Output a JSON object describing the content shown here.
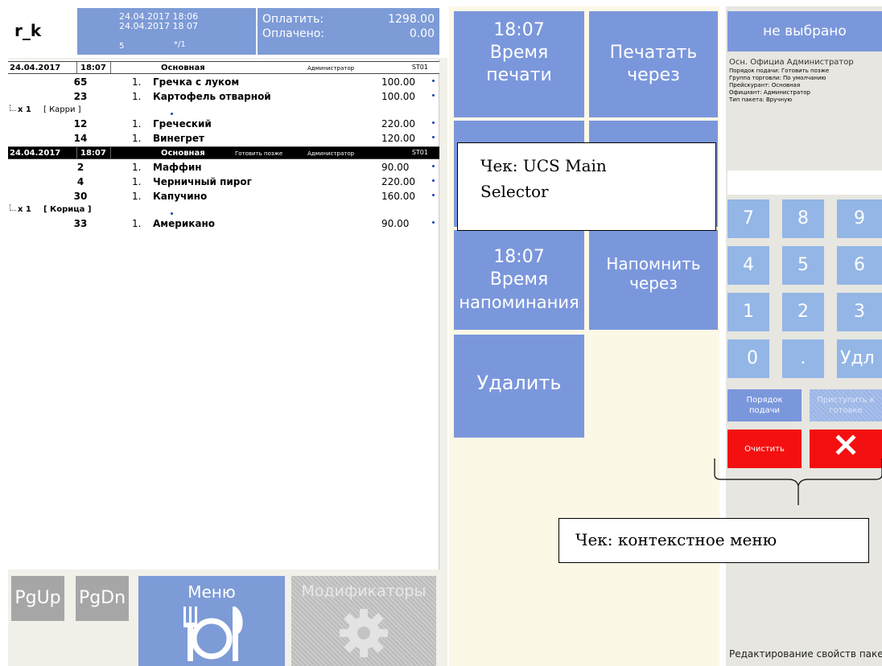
{
  "header": {
    "app_code": "r_k",
    "datetime_open": "24.04.2017 18:06",
    "datetime_print": "24.04.2017 18 07",
    "guests": "5",
    "table": "*/1",
    "pay_label": "Оплатить:",
    "pay_value": "1298.00",
    "paid_label": "Оплачено:",
    "paid_value": "0.00"
  },
  "groups": [
    {
      "date": "24.04.2017",
      "time": "18:07",
      "name": "Основная",
      "later": "",
      "waiter": "Администратор",
      "station": "ST01",
      "selected": false
    },
    {
      "date": "24.04.2017",
      "time": "18:07",
      "name": "Основная",
      "later": "Готовить позже",
      "waiter": "Администратор",
      "station": "ST01",
      "selected": true
    }
  ],
  "items": [
    {
      "code": "65",
      "qty": "1.",
      "name": "Гречка с луком",
      "price": "100.00"
    },
    {
      "code": "23",
      "qty": "1.",
      "name": "Картофель отварной",
      "price": "100.00"
    },
    {
      "mult": "x 1",
      "modifier": "[ Карри ]"
    },
    {
      "code": "12",
      "qty": "1.",
      "name": "Греческий",
      "price": "220.00"
    },
    {
      "code": "14",
      "qty": "1.",
      "name": "Винегрет",
      "price": "120.00"
    },
    {
      "code": "2",
      "qty": "1.",
      "name": "Маффин",
      "price": "90.00"
    },
    {
      "code": "4",
      "qty": "1.",
      "name": "Черничный пирог",
      "price": "220.00"
    },
    {
      "code": "30",
      "qty": "1.",
      "name": "Капучино",
      "price": "160.00"
    },
    {
      "mult": "x 1",
      "modifier": "[ Корица ]"
    },
    {
      "code": "33",
      "qty": "1.",
      "name": "Американо",
      "price": "90.00"
    }
  ],
  "bottom": {
    "pgup": "PgUp",
    "pgdn": "PgDn",
    "menu": "Меню",
    "modifiers": "Модификаторы"
  },
  "middle": {
    "print_time": "18:07",
    "print_time_l1": "Время",
    "print_time_l2": "печати",
    "print_after_l1": "Печатать",
    "print_after_l2": "через",
    "remind_time": "18:07",
    "remind_time_l1": "Время",
    "remind_time_l2": "напоминания",
    "remind_after_l1": "Напомнить",
    "remind_after_l2": "через",
    "delete": "Удалить"
  },
  "right": {
    "not_selected": "не выбрано",
    "summary": "Осн. Официа    Администратор",
    "prop1": "Порядок подачи: Готовить позже",
    "prop2": "Группа торговли: По умолчанию",
    "prop3": "Прейскурант: Основная",
    "prop4": "Официант: Администратор",
    "prop5": "Тип пакета: Вручную",
    "keys": [
      "7",
      "8",
      "9",
      "4",
      "5",
      "6",
      "1",
      "2",
      "3",
      "0",
      ".",
      "Удл"
    ],
    "order_l1": "Порядок",
    "order_l2": "подачи",
    "start_l1": "Приступить к",
    "start_l2": "готовке",
    "clear": "Очистить",
    "status": "Редактирование свойств пакета"
  },
  "annotations": {
    "selector_l1": "Чек: UCS Main",
    "selector_l2": "Selector",
    "context_menu": "Чек: контекстное меню"
  },
  "colors": {
    "tile_blue": "#7b97dc",
    "key_blue": "#93b6e6",
    "red": "#f41010",
    "gray_button": "#a6a6a6",
    "header_blue": "#7d9bd6"
  }
}
